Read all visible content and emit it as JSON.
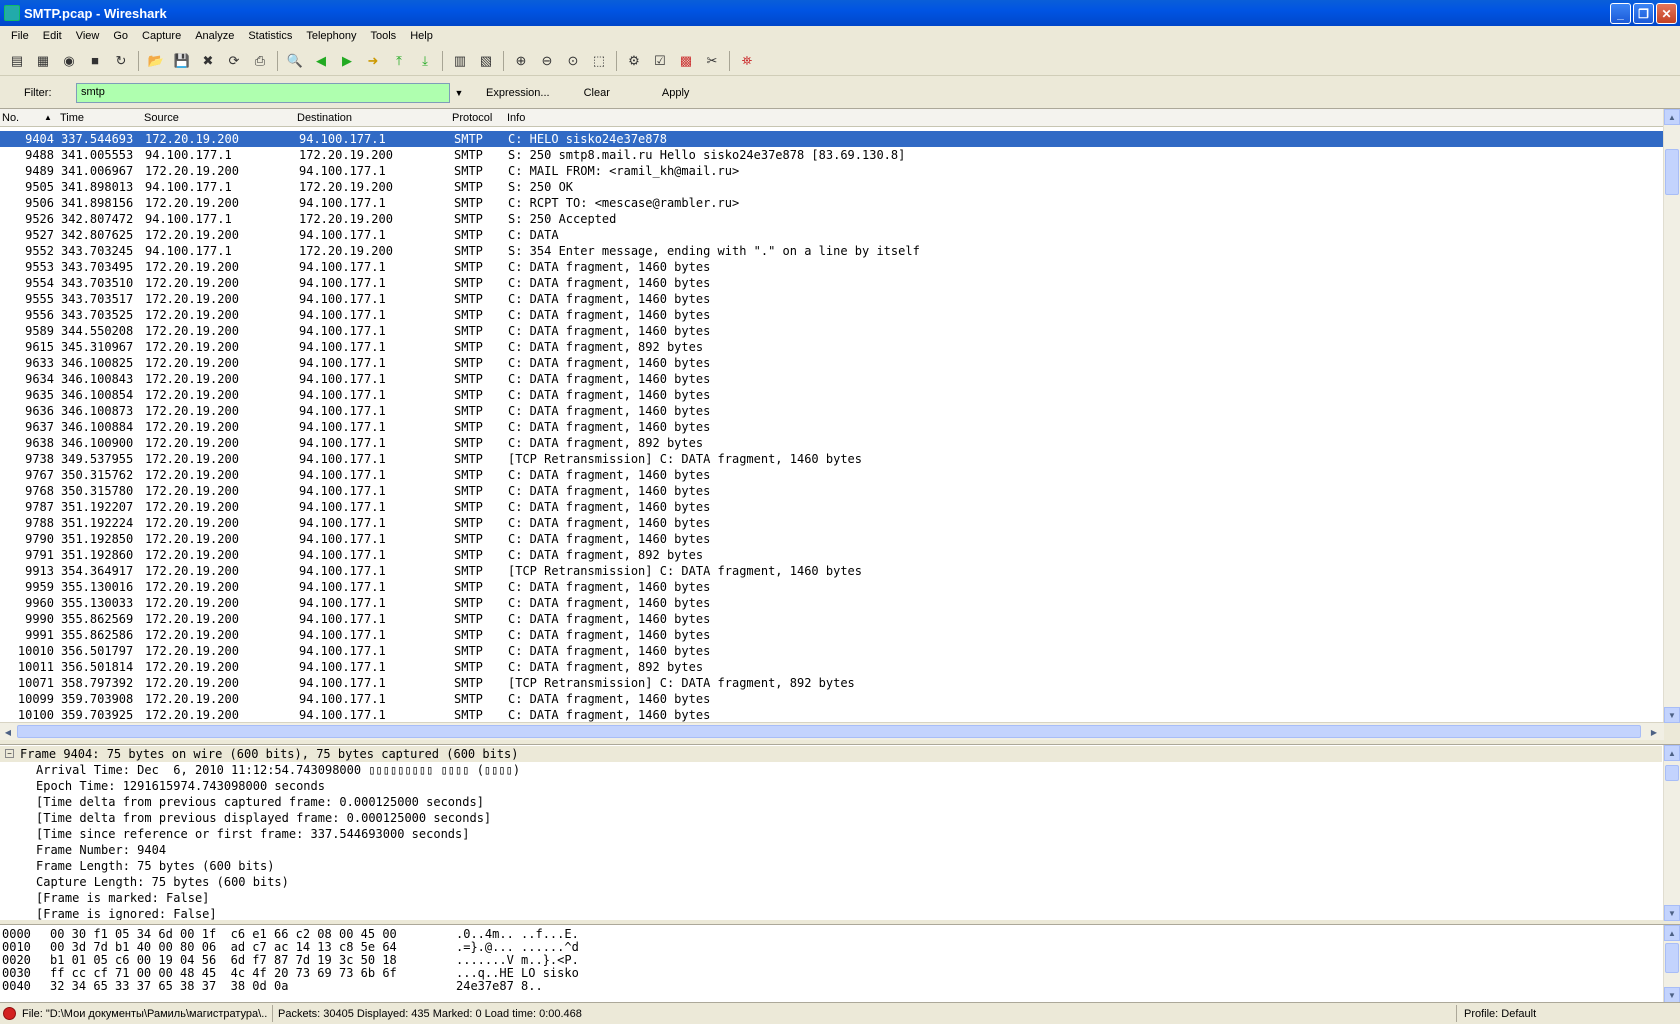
{
  "window": {
    "title": "SMTP.pcap - Wireshark"
  },
  "menu": [
    "File",
    "Edit",
    "View",
    "Go",
    "Capture",
    "Analyze",
    "Statistics",
    "Telephony",
    "Tools",
    "Help"
  ],
  "filter": {
    "label": "Filter:",
    "value": "smtp",
    "expression": "Expression...",
    "clear": "Clear",
    "apply": "Apply"
  },
  "columns": {
    "no": "No.",
    "time": "Time",
    "source": "Source",
    "destination": "Destination",
    "protocol": "Protocol",
    "info": "Info"
  },
  "packets": [
    {
      "no": "9404",
      "time": "337.544693",
      "src": "172.20.19.200",
      "dst": "94.100.177.1",
      "proto": "SMTP",
      "info": "C: HELO sisko24e37e878"
    },
    {
      "no": "9488",
      "time": "341.005553",
      "src": "94.100.177.1",
      "dst": "172.20.19.200",
      "proto": "SMTP",
      "info": "S: 250 smtp8.mail.ru Hello sisko24e37e878 [83.69.130.8]"
    },
    {
      "no": "9489",
      "time": "341.006967",
      "src": "172.20.19.200",
      "dst": "94.100.177.1",
      "proto": "SMTP",
      "info": "C: MAIL FROM: <ramil_kh@mail.ru>"
    },
    {
      "no": "9505",
      "time": "341.898013",
      "src": "94.100.177.1",
      "dst": "172.20.19.200",
      "proto": "SMTP",
      "info": "S: 250 OK"
    },
    {
      "no": "9506",
      "time": "341.898156",
      "src": "172.20.19.200",
      "dst": "94.100.177.1",
      "proto": "SMTP",
      "info": "C: RCPT TO: <mescase@rambler.ru>"
    },
    {
      "no": "9526",
      "time": "342.807472",
      "src": "94.100.177.1",
      "dst": "172.20.19.200",
      "proto": "SMTP",
      "info": "S: 250 Accepted"
    },
    {
      "no": "9527",
      "time": "342.807625",
      "src": "172.20.19.200",
      "dst": "94.100.177.1",
      "proto": "SMTP",
      "info": "C: DATA"
    },
    {
      "no": "9552",
      "time": "343.703245",
      "src": "94.100.177.1",
      "dst": "172.20.19.200",
      "proto": "SMTP",
      "info": "S: 354 Enter message, ending with \".\" on a line by itself"
    },
    {
      "no": "9553",
      "time": "343.703495",
      "src": "172.20.19.200",
      "dst": "94.100.177.1",
      "proto": "SMTP",
      "info": "C: DATA fragment, 1460 bytes"
    },
    {
      "no": "9554",
      "time": "343.703510",
      "src": "172.20.19.200",
      "dst": "94.100.177.1",
      "proto": "SMTP",
      "info": "C: DATA fragment, 1460 bytes"
    },
    {
      "no": "9555",
      "time": "343.703517",
      "src": "172.20.19.200",
      "dst": "94.100.177.1",
      "proto": "SMTP",
      "info": "C: DATA fragment, 1460 bytes"
    },
    {
      "no": "9556",
      "time": "343.703525",
      "src": "172.20.19.200",
      "dst": "94.100.177.1",
      "proto": "SMTP",
      "info": "C: DATA fragment, 1460 bytes"
    },
    {
      "no": "9589",
      "time": "344.550208",
      "src": "172.20.19.200",
      "dst": "94.100.177.1",
      "proto": "SMTP",
      "info": "C: DATA fragment, 1460 bytes"
    },
    {
      "no": "9615",
      "time": "345.310967",
      "src": "172.20.19.200",
      "dst": "94.100.177.1",
      "proto": "SMTP",
      "info": "C: DATA fragment, 892 bytes"
    },
    {
      "no": "9633",
      "time": "346.100825",
      "src": "172.20.19.200",
      "dst": "94.100.177.1",
      "proto": "SMTP",
      "info": "C: DATA fragment, 1460 bytes"
    },
    {
      "no": "9634",
      "time": "346.100843",
      "src": "172.20.19.200",
      "dst": "94.100.177.1",
      "proto": "SMTP",
      "info": "C: DATA fragment, 1460 bytes"
    },
    {
      "no": "9635",
      "time": "346.100854",
      "src": "172.20.19.200",
      "dst": "94.100.177.1",
      "proto": "SMTP",
      "info": "C: DATA fragment, 1460 bytes"
    },
    {
      "no": "9636",
      "time": "346.100873",
      "src": "172.20.19.200",
      "dst": "94.100.177.1",
      "proto": "SMTP",
      "info": "C: DATA fragment, 1460 bytes"
    },
    {
      "no": "9637",
      "time": "346.100884",
      "src": "172.20.19.200",
      "dst": "94.100.177.1",
      "proto": "SMTP",
      "info": "C: DATA fragment, 1460 bytes"
    },
    {
      "no": "9638",
      "time": "346.100900",
      "src": "172.20.19.200",
      "dst": "94.100.177.1",
      "proto": "SMTP",
      "info": "C: DATA fragment, 892 bytes"
    },
    {
      "no": "9738",
      "time": "349.537955",
      "src": "172.20.19.200",
      "dst": "94.100.177.1",
      "proto": "SMTP",
      "info": "[TCP Retransmission] C: DATA fragment, 1460 bytes"
    },
    {
      "no": "9767",
      "time": "350.315762",
      "src": "172.20.19.200",
      "dst": "94.100.177.1",
      "proto": "SMTP",
      "info": "C: DATA fragment, 1460 bytes"
    },
    {
      "no": "9768",
      "time": "350.315780",
      "src": "172.20.19.200",
      "dst": "94.100.177.1",
      "proto": "SMTP",
      "info": "C: DATA fragment, 1460 bytes"
    },
    {
      "no": "9787",
      "time": "351.192207",
      "src": "172.20.19.200",
      "dst": "94.100.177.1",
      "proto": "SMTP",
      "info": "C: DATA fragment, 1460 bytes"
    },
    {
      "no": "9788",
      "time": "351.192224",
      "src": "172.20.19.200",
      "dst": "94.100.177.1",
      "proto": "SMTP",
      "info": "C: DATA fragment, 1460 bytes"
    },
    {
      "no": "9790",
      "time": "351.192850",
      "src": "172.20.19.200",
      "dst": "94.100.177.1",
      "proto": "SMTP",
      "info": "C: DATA fragment, 1460 bytes"
    },
    {
      "no": "9791",
      "time": "351.192860",
      "src": "172.20.19.200",
      "dst": "94.100.177.1",
      "proto": "SMTP",
      "info": "C: DATA fragment, 892 bytes"
    },
    {
      "no": "9913",
      "time": "354.364917",
      "src": "172.20.19.200",
      "dst": "94.100.177.1",
      "proto": "SMTP",
      "info": "[TCP Retransmission] C: DATA fragment, 1460 bytes"
    },
    {
      "no": "9959",
      "time": "355.130016",
      "src": "172.20.19.200",
      "dst": "94.100.177.1",
      "proto": "SMTP",
      "info": "C: DATA fragment, 1460 bytes"
    },
    {
      "no": "9960",
      "time": "355.130033",
      "src": "172.20.19.200",
      "dst": "94.100.177.1",
      "proto": "SMTP",
      "info": "C: DATA fragment, 1460 bytes"
    },
    {
      "no": "9990",
      "time": "355.862569",
      "src": "172.20.19.200",
      "dst": "94.100.177.1",
      "proto": "SMTP",
      "info": "C: DATA fragment, 1460 bytes"
    },
    {
      "no": "9991",
      "time": "355.862586",
      "src": "172.20.19.200",
      "dst": "94.100.177.1",
      "proto": "SMTP",
      "info": "C: DATA fragment, 1460 bytes"
    },
    {
      "no": "10010",
      "time": "356.501797",
      "src": "172.20.19.200",
      "dst": "94.100.177.1",
      "proto": "SMTP",
      "info": "C: DATA fragment, 1460 bytes"
    },
    {
      "no": "10011",
      "time": "356.501814",
      "src": "172.20.19.200",
      "dst": "94.100.177.1",
      "proto": "SMTP",
      "info": "C: DATA fragment, 892 bytes"
    },
    {
      "no": "10071",
      "time": "358.797392",
      "src": "172.20.19.200",
      "dst": "94.100.177.1",
      "proto": "SMTP",
      "info": "[TCP Retransmission] C: DATA fragment, 892 bytes"
    },
    {
      "no": "10099",
      "time": "359.703908",
      "src": "172.20.19.200",
      "dst": "94.100.177.1",
      "proto": "SMTP",
      "info": "C: DATA fragment, 1460 bytes"
    },
    {
      "no": "10100",
      "time": "359.703925",
      "src": "172.20.19.200",
      "dst": "94.100.177.1",
      "proto": "SMTP",
      "info": "C: DATA fragment, 1460 bytes"
    }
  ],
  "details": {
    "top": "Frame 9404: 75 bytes on wire (600 bits), 75 bytes captured (600 bits)",
    "lines": [
      "Arrival Time: Dec  6, 2010 11:12:54.743098000 ▯▯▯▯▯▯▯▯▯ ▯▯▯▯ (▯▯▯▯)",
      "Epoch Time: 1291615974.743098000 seconds",
      "[Time delta from previous captured frame: 0.000125000 seconds]",
      "[Time delta from previous displayed frame: 0.000125000 seconds]",
      "[Time since reference or first frame: 337.544693000 seconds]",
      "Frame Number: 9404",
      "Frame Length: 75 bytes (600 bits)",
      "Capture Length: 75 bytes (600 bits)",
      "[Frame is marked: False]",
      "[Frame is ignored: False]"
    ]
  },
  "hex": [
    {
      "off": "0000",
      "bytes": "00 30 f1 05 34 6d 00 1f  c6 e1 66 c2 08 00 45 00",
      "ascii": ".0..4m.. ..f...E."
    },
    {
      "off": "0010",
      "bytes": "00 3d 7d b1 40 00 80 06  ad c7 ac 14 13 c8 5e 64",
      "ascii": ".=}.@... ......^d"
    },
    {
      "off": "0020",
      "bytes": "b1 01 05 c6 00 19 04 56  6d f7 87 7d 19 3c 50 18",
      "ascii": ".......V m..}.<P."
    },
    {
      "off": "0030",
      "bytes": "ff cc cf 71 00 00 48 45  4c 4f 20 73 69 73 6b 6f",
      "ascii": "...q..HE LO sisko"
    },
    {
      "off": "0040",
      "bytes": "32 34 65 33 37 65 38 37  38 0d 0a",
      "ascii": "24e37e87 8.."
    }
  ],
  "status": {
    "file": "File: \"D:\\Мои документы\\Рамиль\\магистратура\\...",
    "packets": "Packets: 30405 Displayed: 435 Marked: 0 Load time: 0:00.468",
    "profile": "Profile: Default"
  }
}
